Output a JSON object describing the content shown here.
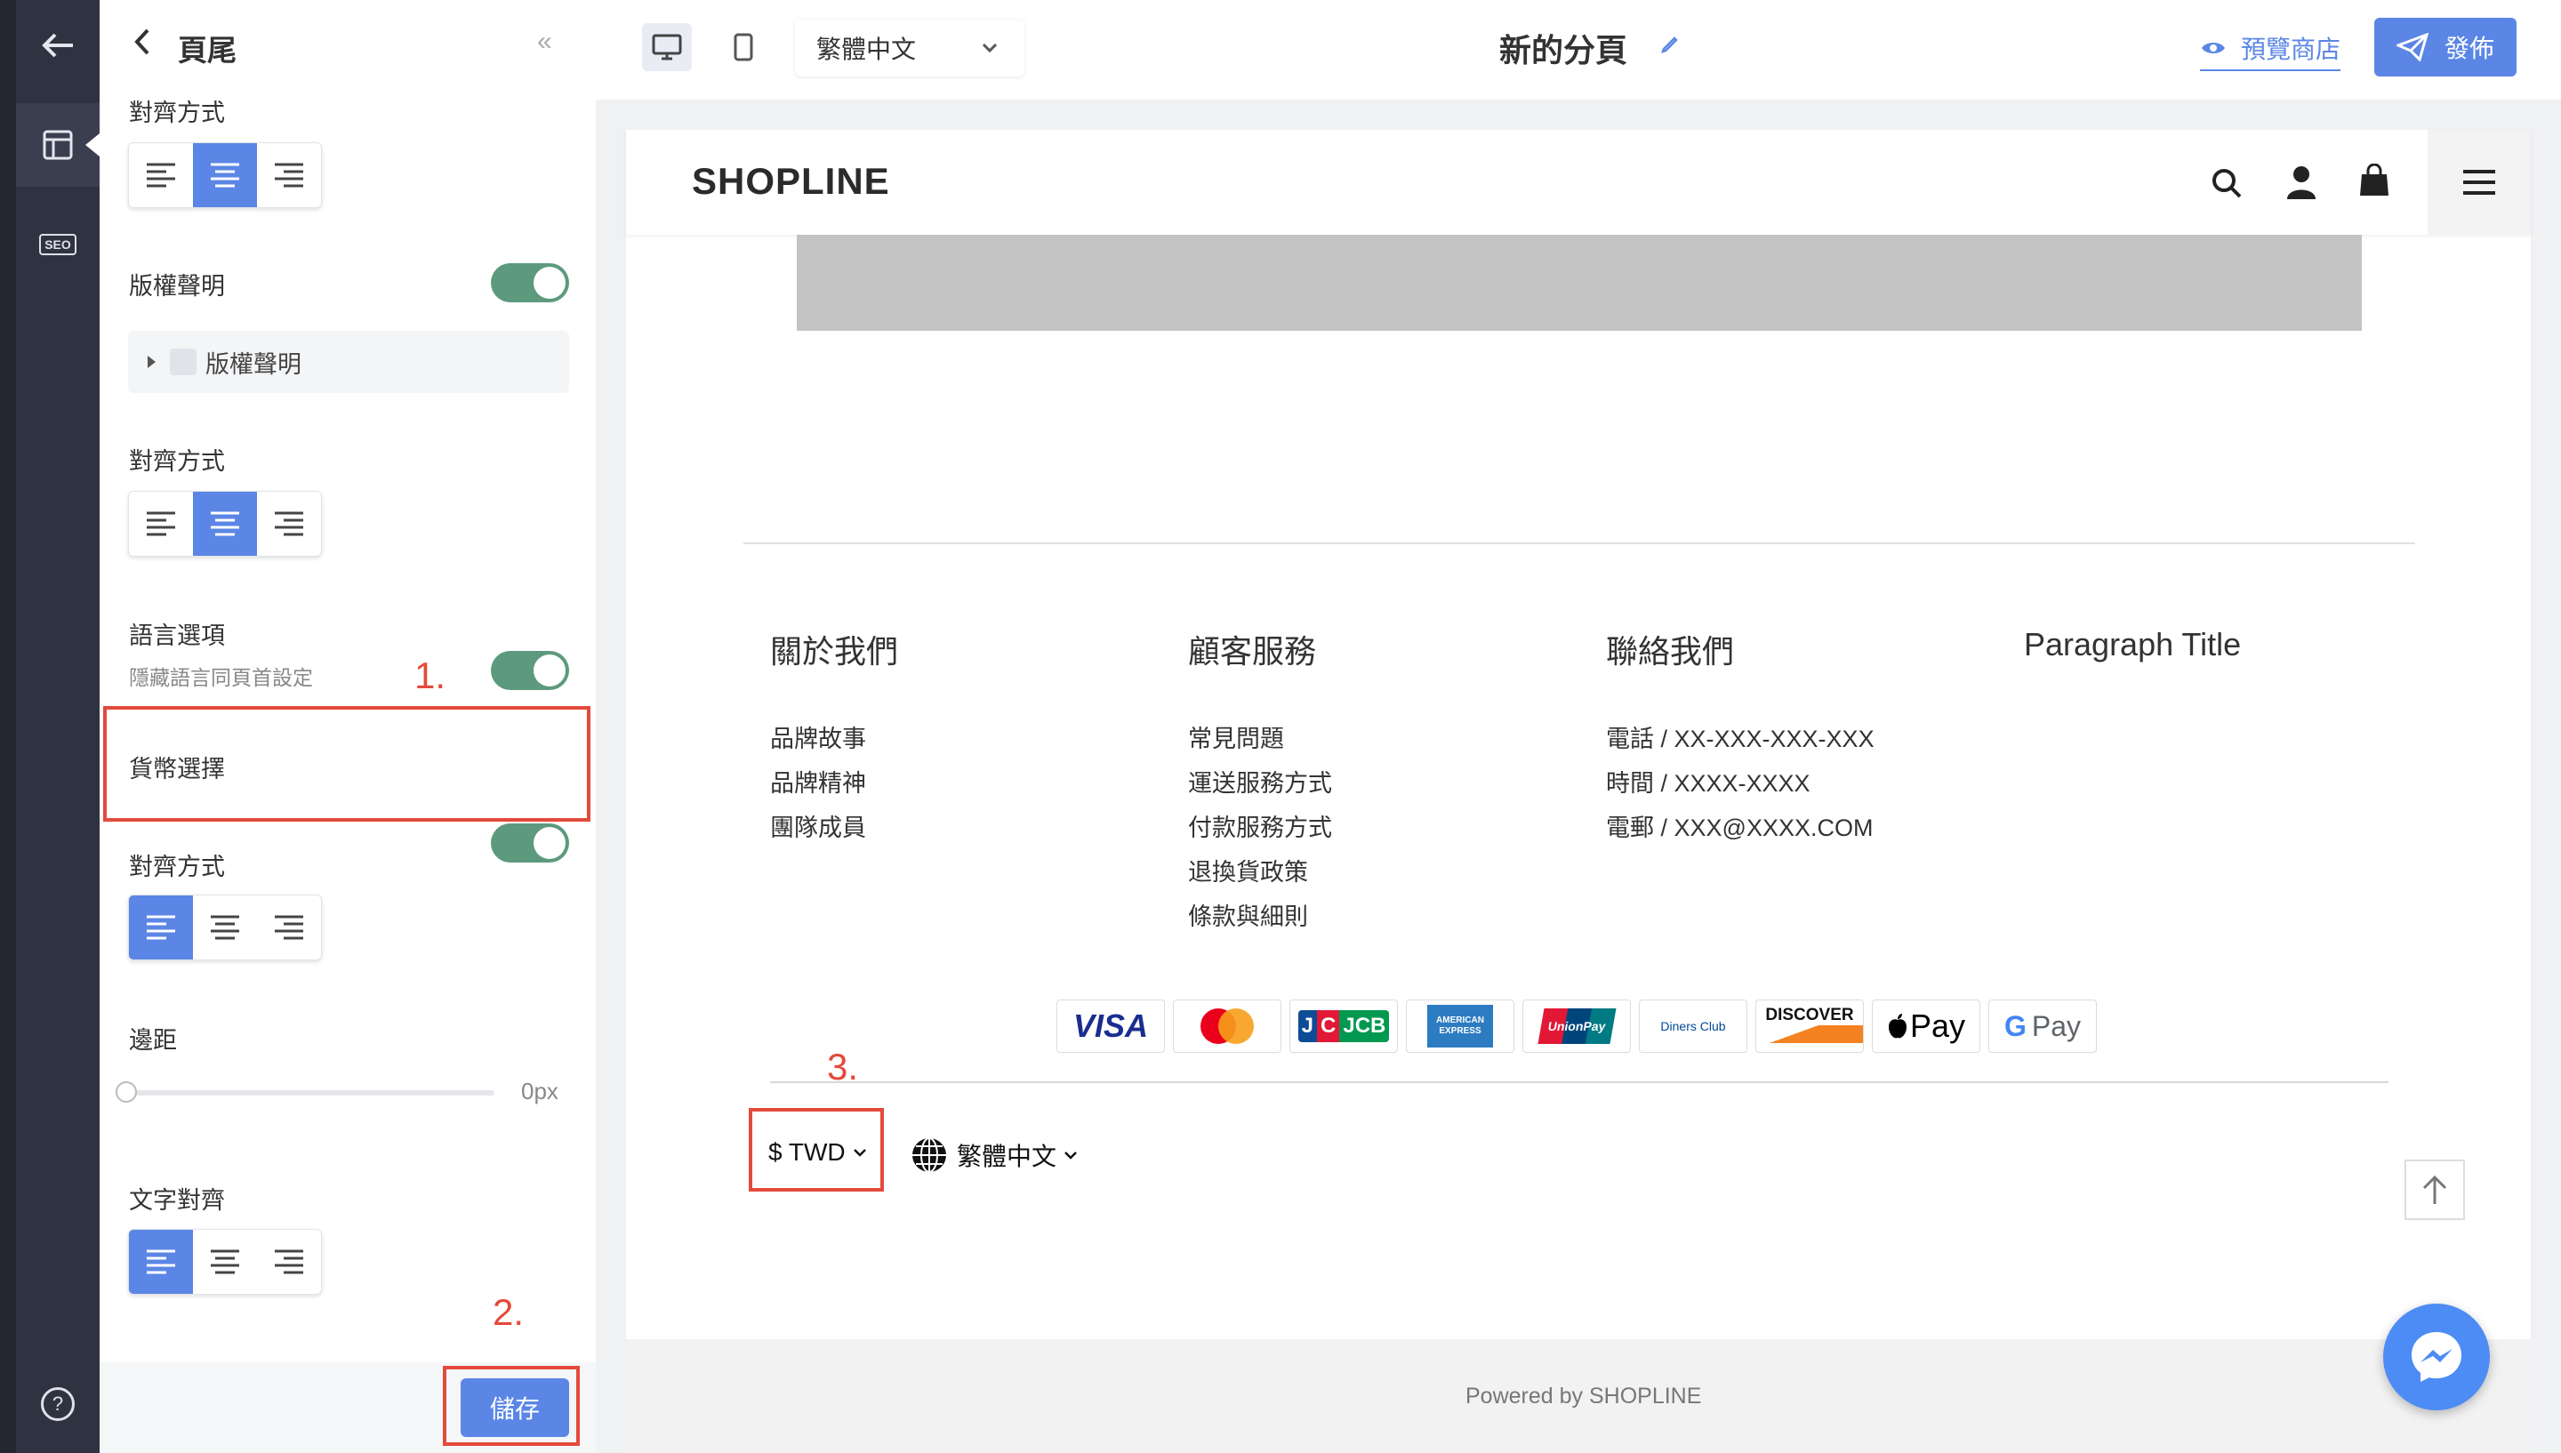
{
  "rail": {
    "seo_label": "SEO",
    "help_label": "?"
  },
  "panel": {
    "title": "頁尾",
    "collapse_icon": "«",
    "align_label_1": "對齊方式",
    "copyright_label": "版權聲明",
    "copyright_tree_item": "版權聲明",
    "align_label_2": "對齊方式",
    "language_label": "語言選項",
    "language_hint": "隱藏語言同頁首設定",
    "currency_label": "貨幣選擇",
    "align_label_3": "對齊方式",
    "margin_label": "邊距",
    "margin_value": "0px",
    "margin_fraction": 0,
    "text_align_label": "文字對齊",
    "save_label": "儲存",
    "annotation_1": "1.",
    "annotation_2": "2.",
    "annotation_3": "3."
  },
  "topbar": {
    "language_select": "繁體中文",
    "page_title": "新的分頁",
    "preview_label": "預覽商店",
    "publish_label": "發佈"
  },
  "store": {
    "logo": "SHOPLINE",
    "columns": [
      {
        "title": "關於我們",
        "links": [
          "品牌故事",
          "品牌精神",
          "團隊成員"
        ]
      },
      {
        "title": "顧客服務",
        "links": [
          "常見問題",
          "運送服務方式",
          "付款服務方式",
          "退換貨政策",
          "條款與細則"
        ]
      },
      {
        "title": "聯絡我們",
        "links": [
          "電話 / XX-XXX-XXX-XXX",
          "時間 / XXXX-XXXX",
          "電郵 / XXX@XXXX.COM"
        ]
      },
      {
        "title": "Paragraph Title",
        "links": []
      }
    ],
    "payments": [
      "VISA",
      "mastercard",
      "JCB",
      "AMERICAN EXPRESS",
      "UnionPay",
      "Diners Club",
      "DISCOVER",
      "Apple Pay",
      "G Pay"
    ],
    "pay_text": {
      "applepay": "Pay",
      "gpay": "Pay",
      "unionpay": "UnionPay",
      "diners": "Diners Club"
    },
    "currency": "$ TWD",
    "language": "繁體中文",
    "powered_by": "Powered by SHOPLINE"
  },
  "colors": {
    "accent": "#5b86e5",
    "toggle": "#5d9a7d",
    "annotation": "#e34a3b",
    "rail": "#2f3240"
  }
}
